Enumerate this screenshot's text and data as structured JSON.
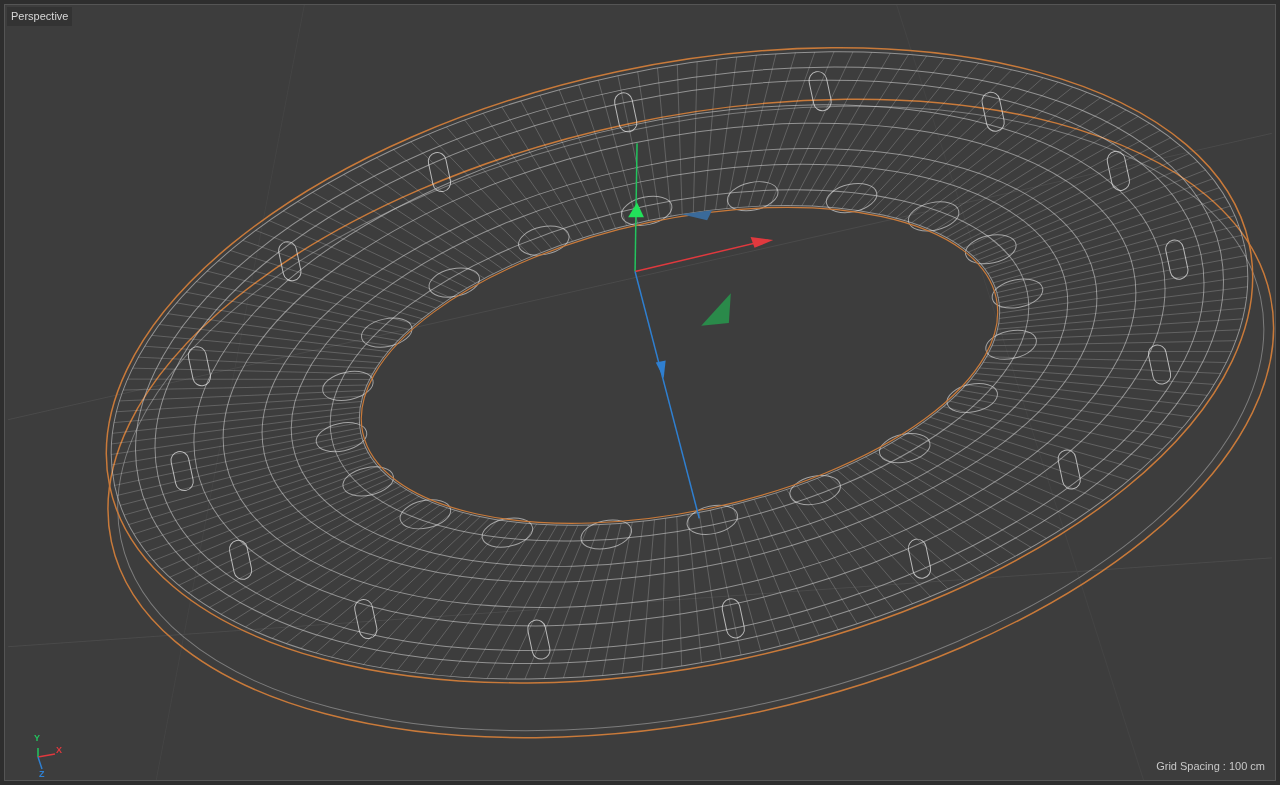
{
  "viewport": {
    "title": "Perspective"
  },
  "axes": [
    {
      "label": "Y",
      "color": "#22c55e"
    },
    {
      "label": "X",
      "color": "#e0393e"
    },
    {
      "label": "Z",
      "color": "#2f7fd0"
    }
  ],
  "grid_spacing": "Grid Spacing : 100 cm"
}
